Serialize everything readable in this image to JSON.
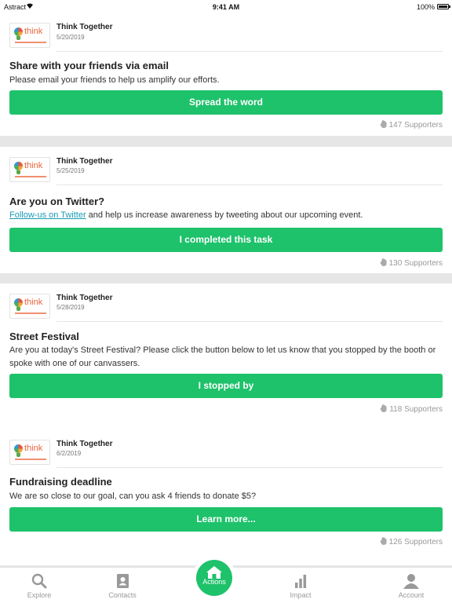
{
  "status_bar": {
    "carrier": "Astract",
    "time": "9:41 AM",
    "battery": "100%"
  },
  "feed": [
    {
      "org": "Think Together",
      "date": "5/20/2019",
      "title": "Share with your friends via email",
      "description": "Please email your friends to help us amplify our efforts.",
      "button": "Spread the word",
      "supporters": "147 Supporters"
    },
    {
      "org": "Think Together",
      "date": "5/25/2019",
      "title": "Are you on Twitter?",
      "link_text": "Follow-us on Twitter",
      "description": " and help us increase awareness by tweeting about our upcoming event.",
      "button": "I completed this task",
      "supporters": "130 Supporters"
    },
    {
      "org": "Think Together",
      "date": "5/28/2019",
      "title": "Street Festival",
      "description": "Are you at today's Street Festival? Please click the button below to let us know that you stopped by the booth or spoke with one of our canvassers.",
      "button": "I stopped by",
      "supporters": "118 Supporters"
    },
    {
      "org": "Think Together",
      "date": "6/2/2019",
      "title": "Fundraising deadline",
      "description": "We are so close to our goal, can you ask 4 friends to donate $5?",
      "button": "Learn more...",
      "supporters": "126 Supporters"
    }
  ],
  "tab_bar": {
    "explore": "Explore",
    "contacts": "Contacts",
    "actions": "Actions",
    "impact": "Impact",
    "account": "Account",
    "active": "actions"
  },
  "colors": {
    "accent": "#1ec26b",
    "link": "#1a9bb5",
    "logo_orange": "#e8643a"
  },
  "logo_text": "think"
}
